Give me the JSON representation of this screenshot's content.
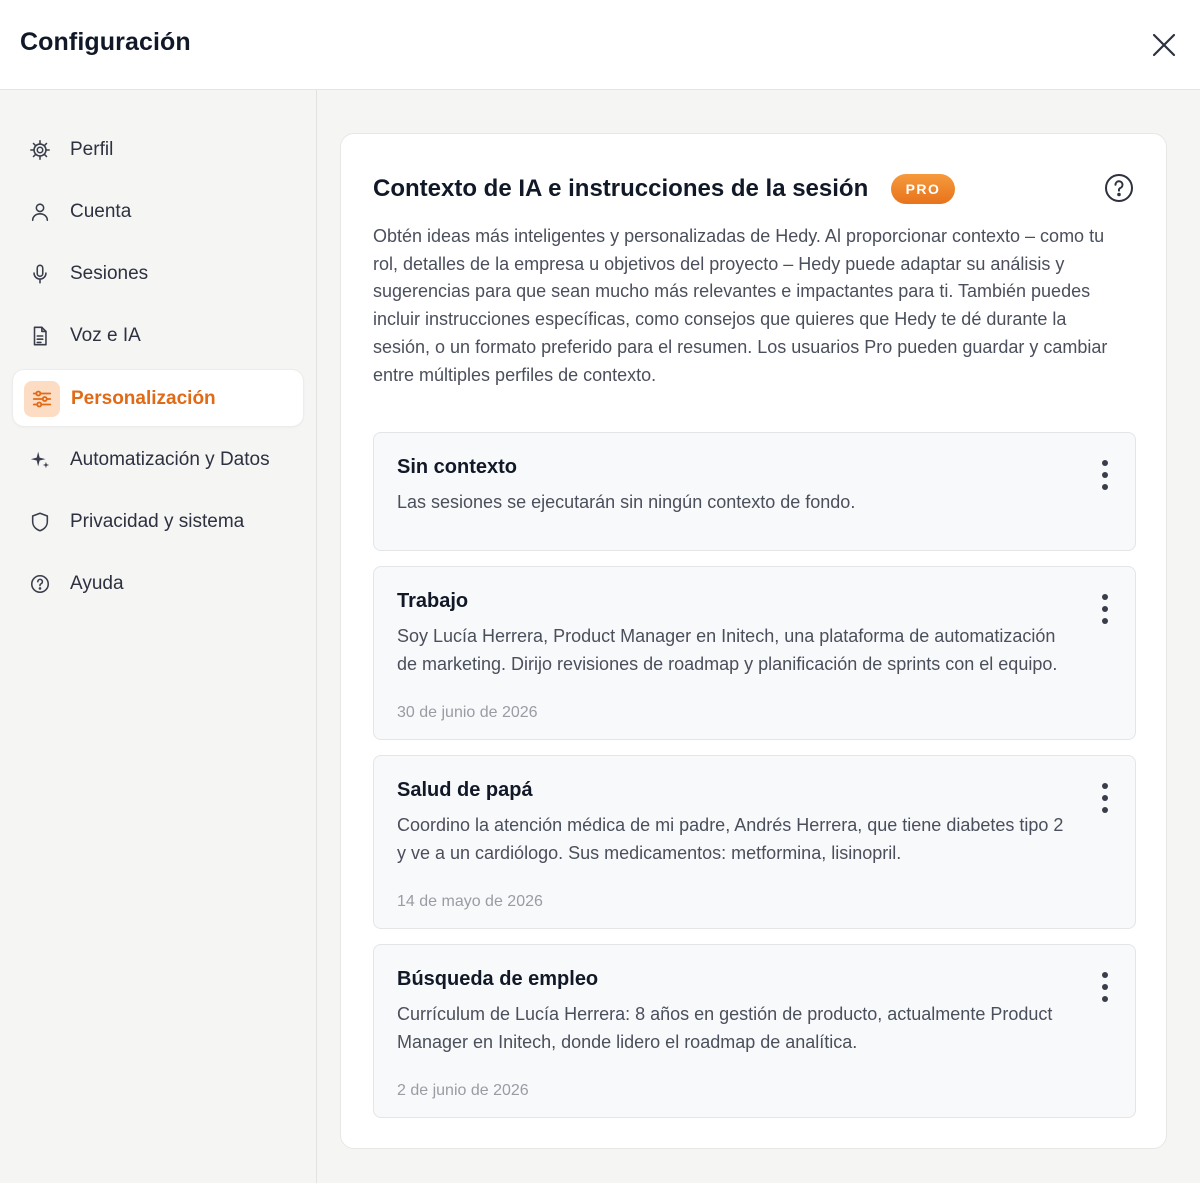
{
  "header": {
    "title": "Configuración"
  },
  "sidebar": {
    "items": [
      {
        "label": "Perfil",
        "icon": "gear-icon"
      },
      {
        "label": "Cuenta",
        "icon": "user-icon"
      },
      {
        "label": "Sesiones",
        "icon": "microphone-icon"
      },
      {
        "label": "Voz e IA",
        "icon": "document-icon"
      },
      {
        "label": "Personalización",
        "icon": "sliders-icon",
        "active": true
      },
      {
        "label": "Automatización y Datos",
        "icon": "sparkles-icon"
      },
      {
        "label": "Privacidad y sistema",
        "icon": "shield-icon"
      },
      {
        "label": "Ayuda",
        "icon": "help-circle-icon"
      }
    ]
  },
  "main": {
    "title": "Contexto de IA e instrucciones de la sesión",
    "badge": "PRO",
    "description": "Obtén ideas más inteligentes y personalizadas de Hedy. Al proporcionar contexto – como tu rol, detalles de la empresa u objetivos del proyecto – Hedy puede adaptar su análisis y sugerencias para que sean mucho más relevantes e impactantes para ti. También puedes incluir instrucciones específicas, como consejos que quieres que Hedy te dé durante la sesión, o un formato preferido para el resumen. Los usuarios Pro pueden guardar y cambiar entre múltiples perfiles de contexto.",
    "contexts": [
      {
        "title": "Sin contexto",
        "description": "Las sesiones se ejecutarán sin ningún contexto de fondo.",
        "date": ""
      },
      {
        "title": "Trabajo",
        "description": "Soy Lucía Herrera, Product Manager en Initech, una plataforma de automatización de marketing. Dirijo revisiones de roadmap y planificación de sprints con el equipo.",
        "date": "30 de junio de 2026"
      },
      {
        "title": "Salud de papá",
        "description": "Coordino la atención médica de mi padre, Andrés Herrera, que tiene diabetes tipo 2 y ve a un cardiólogo. Sus medicamentos: metformina, lisinopril.",
        "date": "14 de mayo de 2026"
      },
      {
        "title": "Búsqueda de empleo",
        "description": "Currículum de Lucía Herrera: 8 años en gestión de producto, actualmente Product Manager en Initech, donde lidero el roadmap de analítica.",
        "date": "2 de junio de 2026"
      }
    ]
  },
  "colors": {
    "accent": "#e16a16",
    "accent_bg": "#fddcc4",
    "badge_gradient_start": "#f59a3c",
    "badge_gradient_end": "#e8731c"
  }
}
